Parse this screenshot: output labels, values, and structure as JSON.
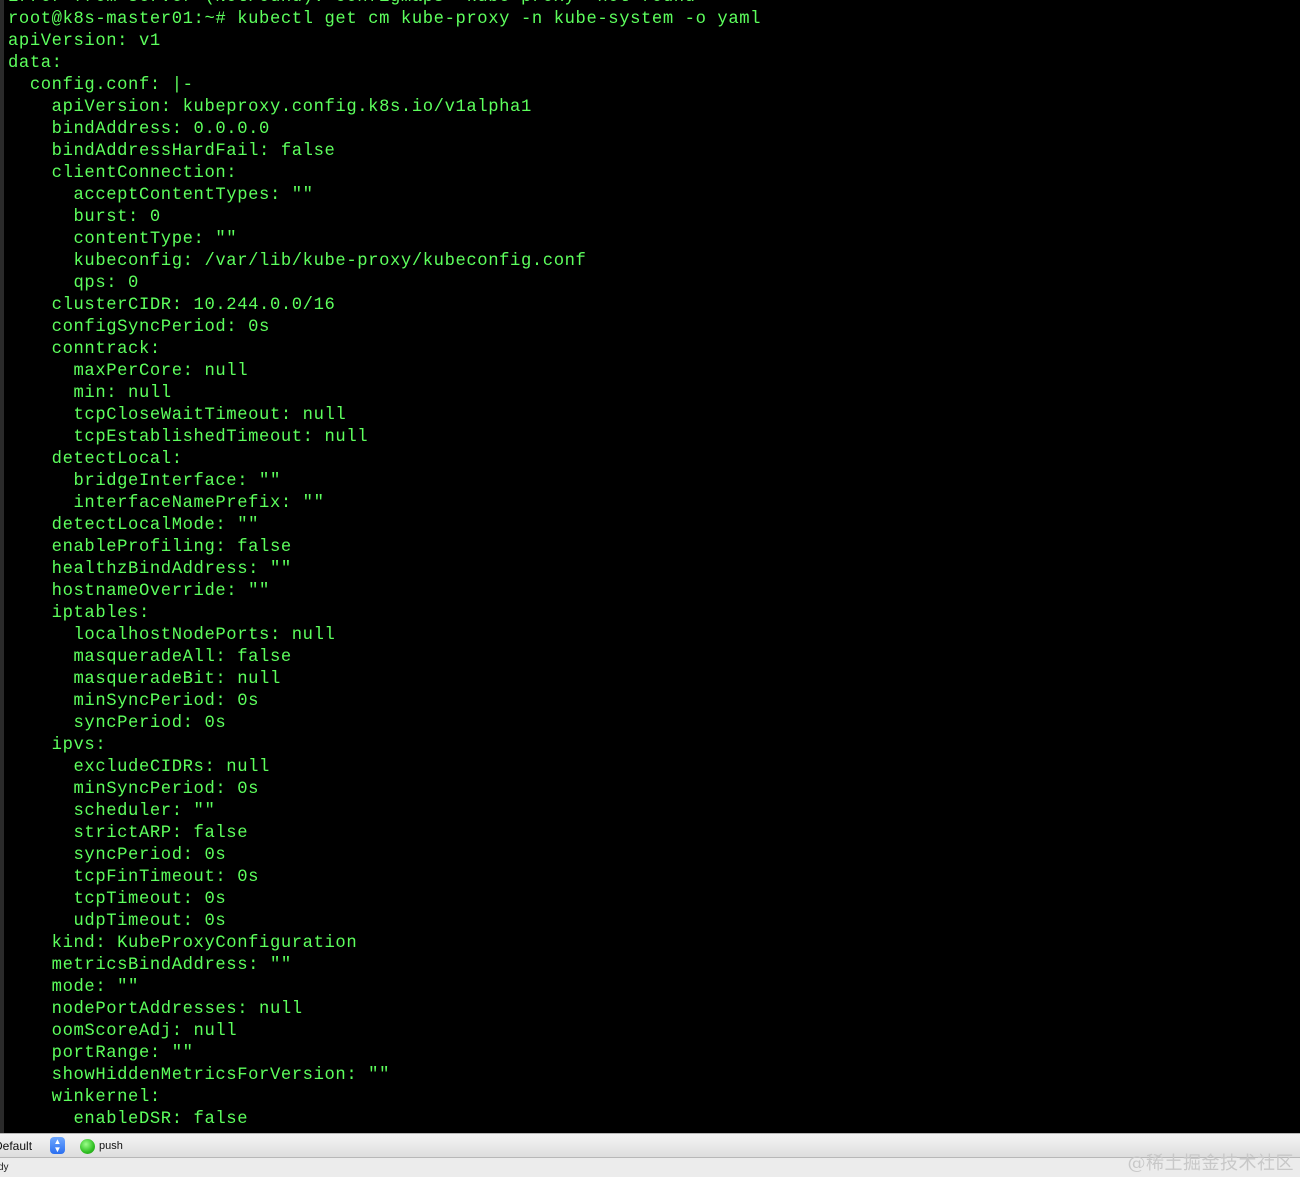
{
  "terminal": {
    "lines": [
      "Error from server (NotFound): configmaps \"kube-proxy\" not found",
      "root@k8s-master01:~# kubectl get cm kube-proxy -n kube-system -o yaml",
      "apiVersion: v1",
      "data:",
      "  config.conf: |-",
      "    apiVersion: kubeproxy.config.k8s.io/v1alpha1",
      "    bindAddress: 0.0.0.0",
      "    bindAddressHardFail: false",
      "    clientConnection:",
      "      acceptContentTypes: \"\"",
      "      burst: 0",
      "      contentType: \"\"",
      "      kubeconfig: /var/lib/kube-proxy/kubeconfig.conf",
      "      qps: 0",
      "    clusterCIDR: 10.244.0.0/16",
      "    configSyncPeriod: 0s",
      "    conntrack:",
      "      maxPerCore: null",
      "      min: null",
      "      tcpCloseWaitTimeout: null",
      "      tcpEstablishedTimeout: null",
      "    detectLocal:",
      "      bridgeInterface: \"\"",
      "      interfaceNamePrefix: \"\"",
      "    detectLocalMode: \"\"",
      "    enableProfiling: false",
      "    healthzBindAddress: \"\"",
      "    hostnameOverride: \"\"",
      "    iptables:",
      "      localhostNodePorts: null",
      "      masqueradeAll: false",
      "      masqueradeBit: null",
      "      minSyncPeriod: 0s",
      "      syncPeriod: 0s",
      "    ipvs:",
      "      excludeCIDRs: null",
      "      minSyncPeriod: 0s",
      "      scheduler: \"\"",
      "      strictARP: false",
      "      syncPeriod: 0s",
      "      tcpFinTimeout: 0s",
      "      tcpTimeout: 0s",
      "      udpTimeout: 0s",
      "    kind: KubeProxyConfiguration",
      "    metricsBindAddress: \"\"",
      "    mode: \"\"",
      "    nodePortAddresses: null",
      "    oomScoreAdj: null",
      "    portRange: \"\"",
      "    showHiddenMetricsForVersion: \"\"",
      "    winkernel:",
      "      enableDSR: false"
    ],
    "text_color": "#5dff5d",
    "background": "#000000"
  },
  "toolbar": {
    "profile_select_value": "Default",
    "profile_select_icon": "updown-chevron-icon",
    "push_label": "push",
    "push_icon": "green-status-dot-icon"
  },
  "status": {
    "text": "dy"
  },
  "watermark": {
    "text": "@稀土掘金技术社区"
  }
}
